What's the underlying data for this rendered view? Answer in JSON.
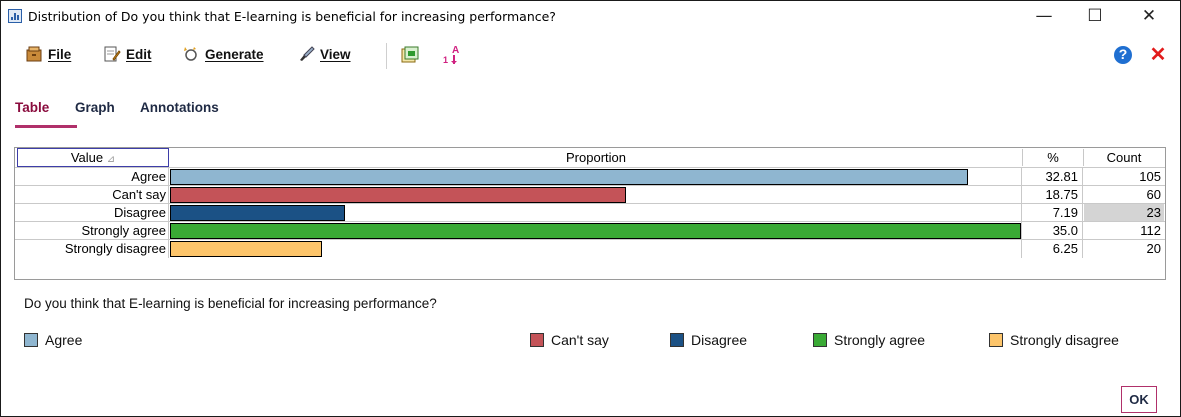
{
  "window": {
    "title": "Distribution of Do you think that E-learning is beneficial for increasing performance?",
    "minimize_glyph": "—",
    "maximize_glyph": "☐",
    "close_glyph": "✕"
  },
  "menu": {
    "file": "File",
    "edit": "Edit",
    "generate": "Generate",
    "view": "View",
    "help_glyph": "?",
    "close_glyph": "✕"
  },
  "tabs": [
    {
      "label": "Table",
      "active": true
    },
    {
      "label": "Graph",
      "active": false
    },
    {
      "label": "Annotations",
      "active": false
    }
  ],
  "table": {
    "headers": {
      "value": "Value",
      "sort_glyph": "⊿",
      "proportion": "Proportion",
      "percent": "%",
      "count": "Count"
    },
    "rows": [
      {
        "label": "Agree",
        "percent": "32.81",
        "count": "105",
        "color": "#8fb6d0"
      },
      {
        "label": "Can't say",
        "percent": "18.75",
        "count": "60",
        "color": "#c45358"
      },
      {
        "label": "Disagree",
        "percent": "7.19",
        "count": "23",
        "color": "#1b5185"
      },
      {
        "label": "Strongly agree",
        "percent": "35.0",
        "count": "112",
        "color": "#3aaa35"
      },
      {
        "label": "Strongly disagree",
        "percent": "6.25",
        "count": "20",
        "color": "#fdc56b"
      }
    ]
  },
  "question": "Do you think that E-learning is beneficial for increasing performance?",
  "legend": [
    {
      "label": "Agree",
      "color": "#8fb6d0"
    },
    {
      "label": "Can't say",
      "color": "#c45358"
    },
    {
      "label": "Disagree",
      "color": "#1b5185"
    },
    {
      "label": "Strongly agree",
      "color": "#3aaa35"
    },
    {
      "label": "Strongly disagree",
      "color": "#fdc56b"
    }
  ],
  "ok_label": "OK"
}
